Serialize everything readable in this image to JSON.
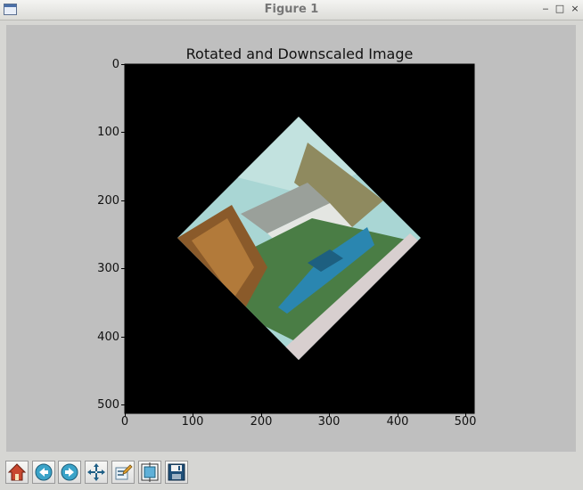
{
  "window": {
    "title": "Figure 1"
  },
  "figure": {
    "title": "Rotated and Downscaled Image",
    "x_ticks": [
      "0",
      "100",
      "200",
      "300",
      "400",
      "500"
    ],
    "y_ticks": [
      "0",
      "100",
      "200",
      "300",
      "400",
      "500"
    ],
    "image": {
      "width": 512,
      "height": 512,
      "background": "black",
      "content": "rotated photo of a house with a blue car"
    }
  },
  "chart_data": {
    "type": "heatmap",
    "title": "Rotated and Downscaled Image",
    "xlabel": "",
    "ylabel": "",
    "xlim": [
      0,
      512
    ],
    "ylim": [
      512,
      0
    ],
    "x_ticks": [
      0,
      100,
      200,
      300,
      400,
      500
    ],
    "y_ticks": [
      0,
      100,
      200,
      300,
      400,
      500
    ]
  },
  "toolbar": {
    "buttons": [
      {
        "icon": "home-icon"
      },
      {
        "icon": "back-icon"
      },
      {
        "icon": "forward-icon"
      },
      {
        "icon": "pan-icon"
      },
      {
        "icon": "edit-icon"
      },
      {
        "icon": "subplots-icon"
      },
      {
        "icon": "save-icon"
      }
    ]
  },
  "colors": {
    "sky": "#a9d6d4",
    "car": "#2a86b0",
    "grass": "#4a7d45",
    "road": "#d8cfcf"
  }
}
